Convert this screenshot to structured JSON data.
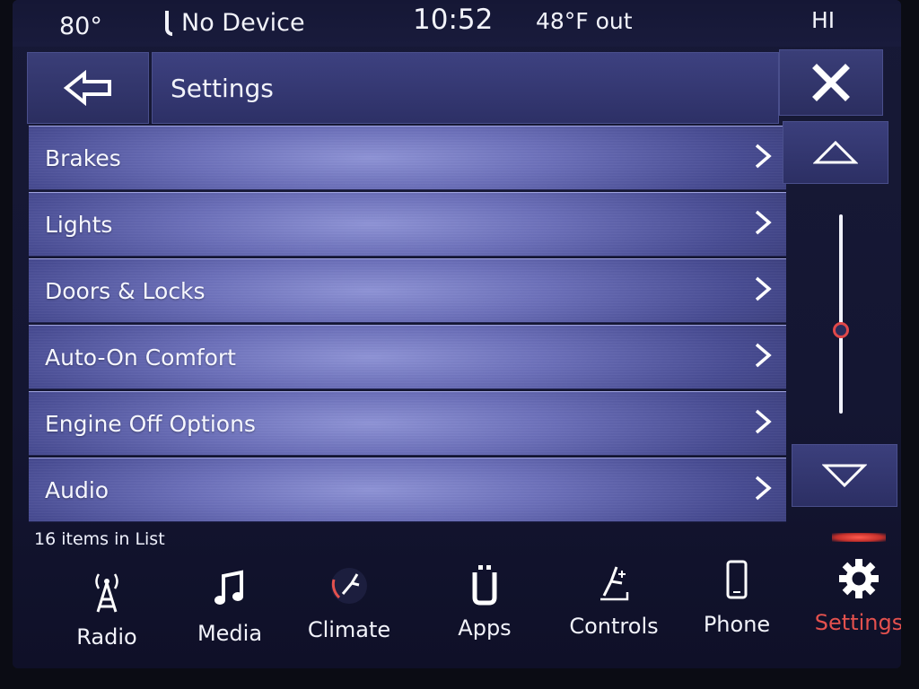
{
  "status_bar": {
    "temperature": "80°",
    "device": "No Device",
    "time": "10:52",
    "outside_temp": "48°F out",
    "fan_level": "HI"
  },
  "header": {
    "title": "Settings",
    "back_icon": "arrow-left-icon",
    "close_icon": "close-icon"
  },
  "settings_list": {
    "items": [
      {
        "label": "Brakes"
      },
      {
        "label": "Lights"
      },
      {
        "label": "Doors & Locks"
      },
      {
        "label": "Auto-On Comfort"
      },
      {
        "label": "Engine Off Options"
      },
      {
        "label": "Audio"
      }
    ],
    "count_text": "16 items in List",
    "scroll_position": 0.58
  },
  "bottom_nav": {
    "items": [
      {
        "label": "Radio",
        "icon": "radio-tower-icon",
        "active": false
      },
      {
        "label": "Media",
        "icon": "music-note-icon",
        "active": false
      },
      {
        "label": "Climate",
        "icon": "climate-seat-icon",
        "active": false
      },
      {
        "label": "Apps",
        "icon": "apps-icon",
        "active": false
      },
      {
        "label": "Controls",
        "icon": "controls-seat-icon",
        "active": false
      },
      {
        "label": "Phone",
        "icon": "phone-icon",
        "active": false
      },
      {
        "label": "Settings",
        "icon": "gear-icon",
        "active": true
      }
    ]
  },
  "colors": {
    "accent": "#e4514e",
    "header_bg": "#2d3066",
    "list_bg": "#6a6eb8"
  }
}
